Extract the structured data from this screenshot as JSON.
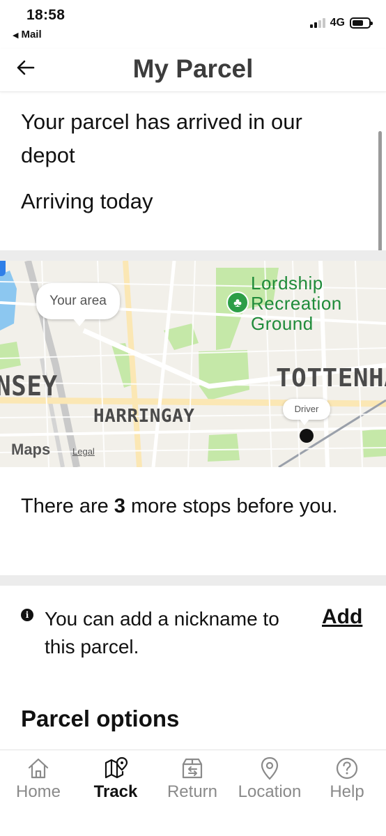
{
  "status_bar": {
    "time": "18:58",
    "back_app": "Mail",
    "network": "4G"
  },
  "header": {
    "title": "My Parcel",
    "back_icon": "arrow-left-icon"
  },
  "tracking": {
    "status_headline": "Your parcel has arrived in our depot",
    "eta": "Arriving today"
  },
  "map": {
    "your_area_label": "Your area",
    "driver_label": "Driver",
    "places": {
      "nsey": "NSEY",
      "harringay": "HARRINGAY",
      "tottenham": "TOTTENHA",
      "park": [
        "Lordship",
        "Recreation",
        "Ground"
      ]
    },
    "attribution": "Maps",
    "legal": "Legal",
    "colors": {
      "background": "#f2f0ea",
      "park": "#c5e8a8",
      "road_major": "#fbe7b4",
      "water": "#8cc7f0"
    }
  },
  "stops": {
    "prefix": "There are ",
    "count": "3",
    "suffix": " more stops before you."
  },
  "nickname": {
    "text": "You can add a nickname to this parcel.",
    "action": "Add"
  },
  "parcel_options": {
    "title": "Parcel options"
  },
  "tabbar": {
    "items": [
      {
        "label": "Home",
        "icon": "home-icon",
        "active": false
      },
      {
        "label": "Track",
        "icon": "map-pin-icon",
        "active": true
      },
      {
        "label": "Return",
        "icon": "return-box-icon",
        "active": false
      },
      {
        "label": "Location",
        "icon": "location-pin-icon",
        "active": false
      },
      {
        "label": "Help",
        "icon": "help-icon",
        "active": false
      }
    ]
  }
}
